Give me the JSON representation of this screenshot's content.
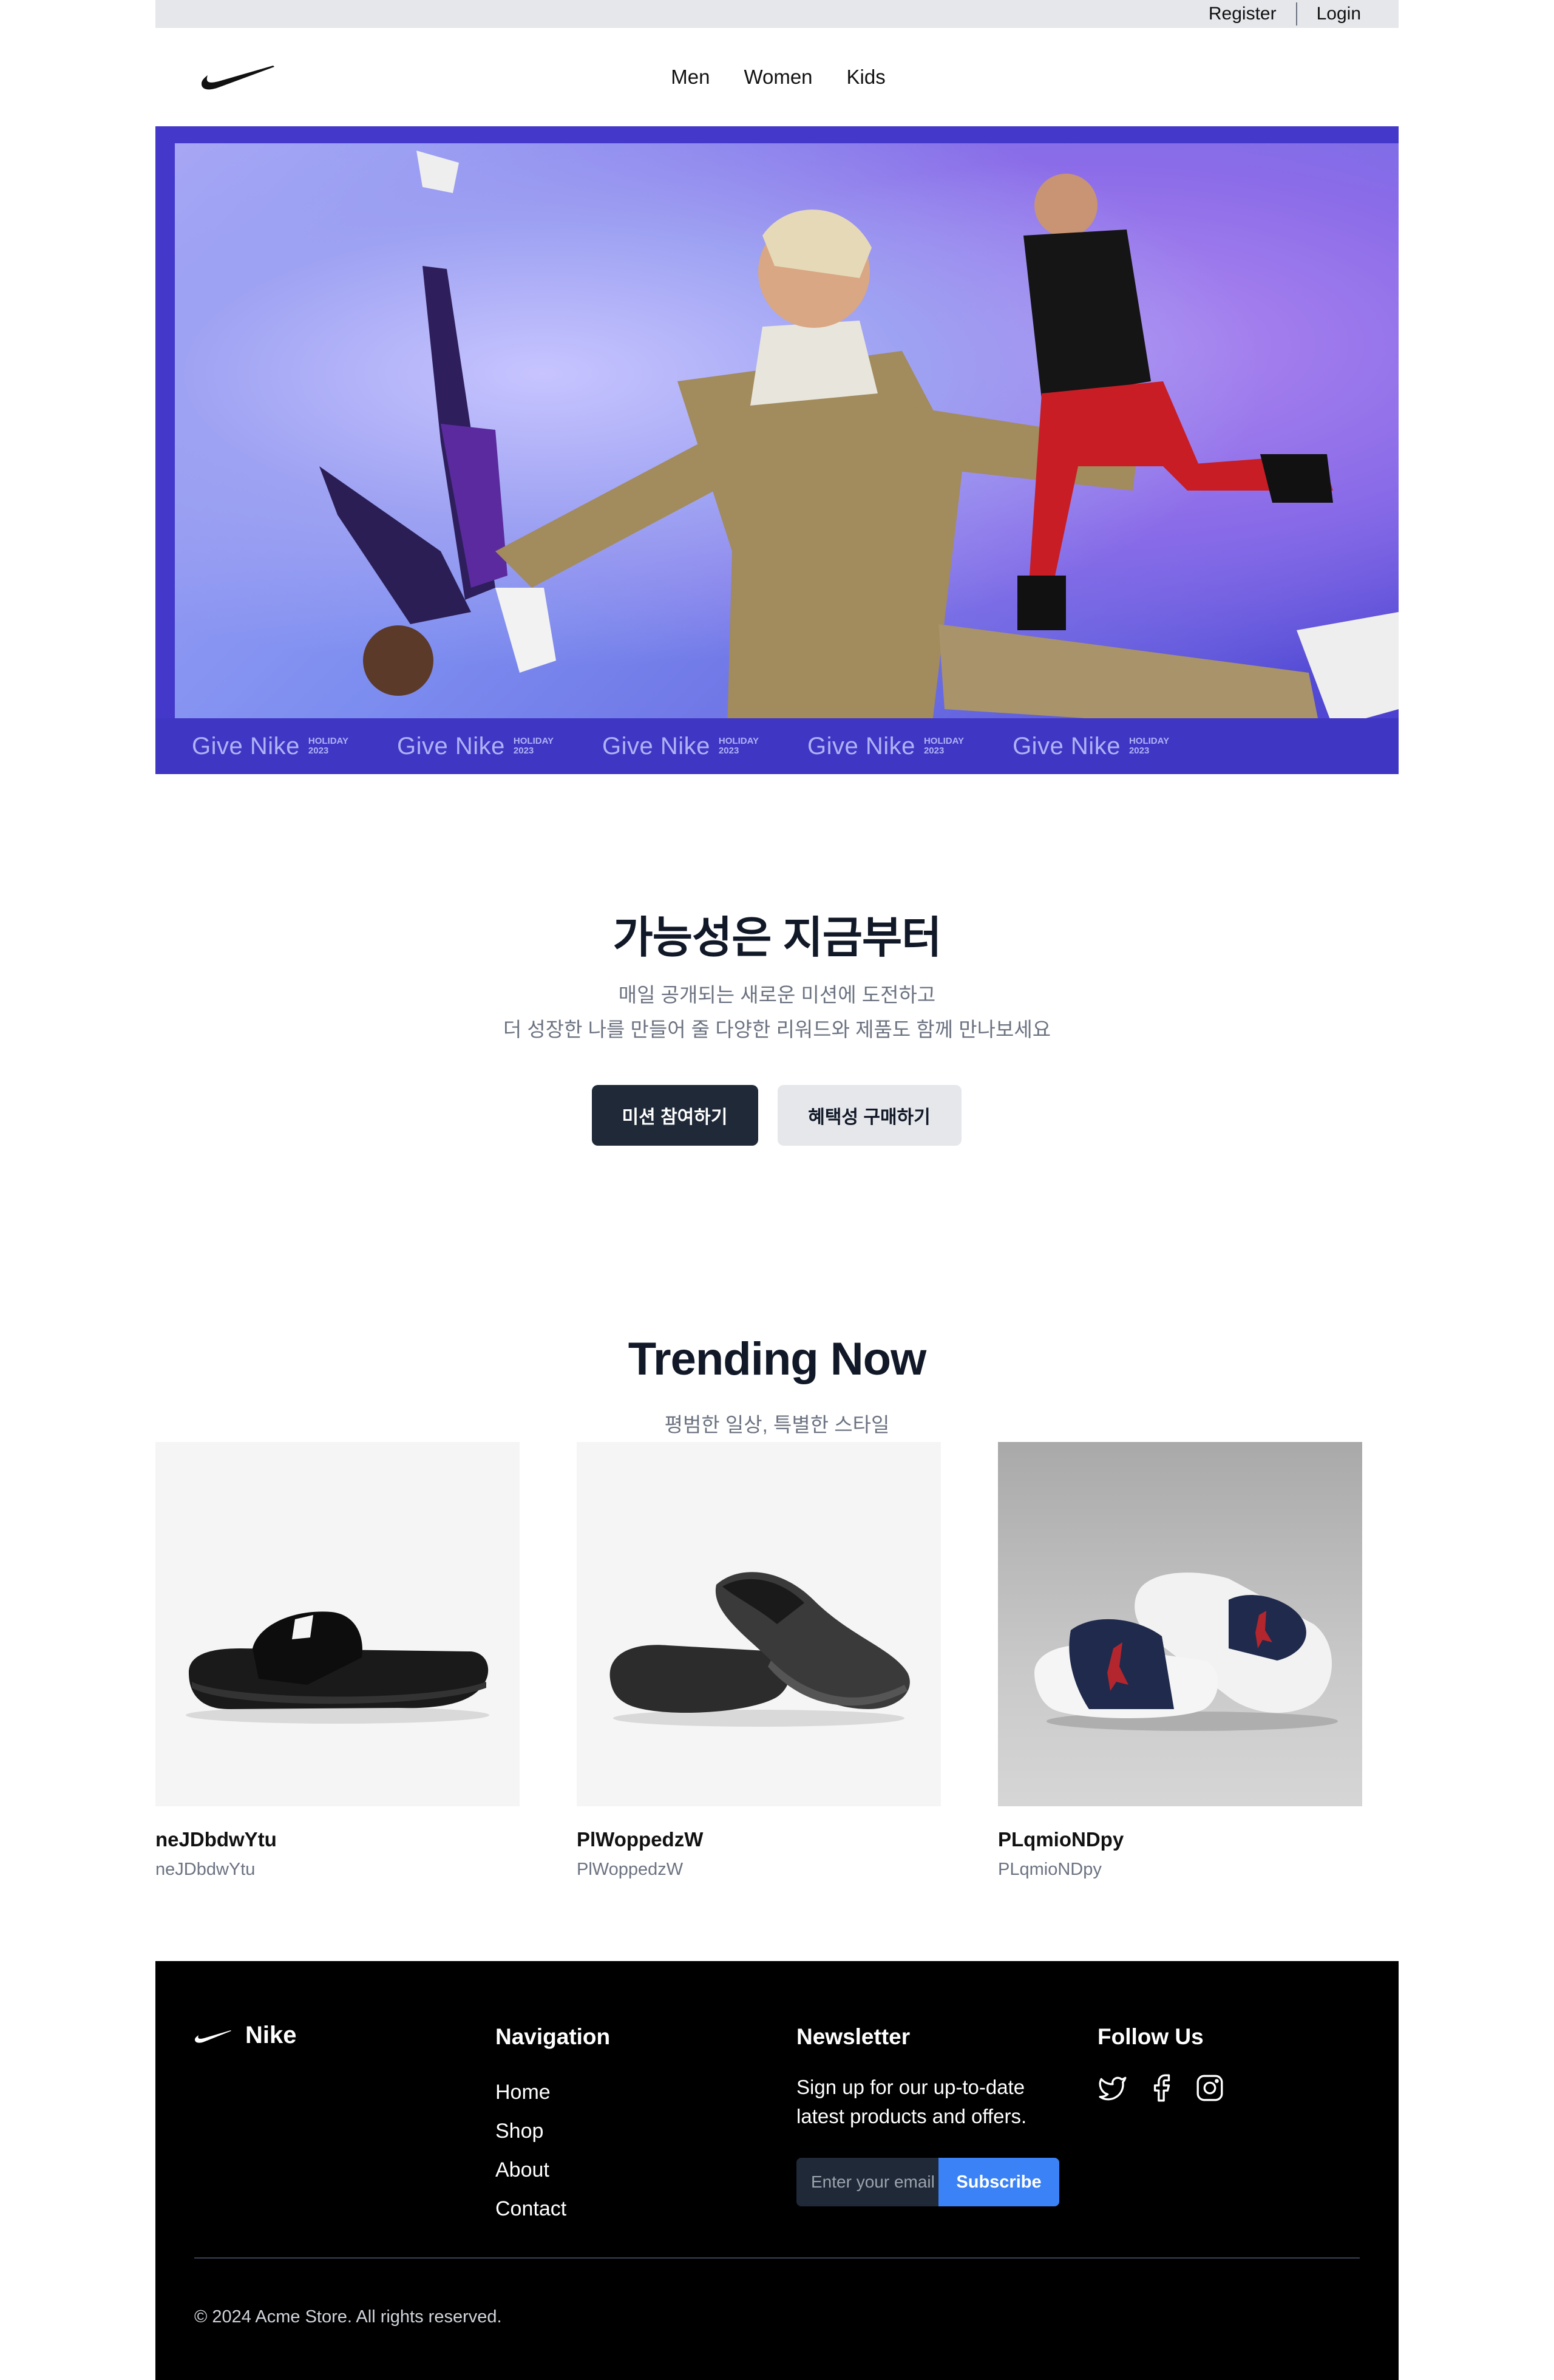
{
  "topbar": {
    "register": "Register",
    "login": "Login"
  },
  "header": {
    "logo_icon": "nike-swoosh-icon",
    "nav": [
      "Men",
      "Women",
      "Kids"
    ]
  },
  "hero": {
    "strip_text": "Give Nike",
    "strip_badge_top": "HOLIDAY",
    "strip_badge_bottom": "2023",
    "colors": {
      "frame": "#4338ca",
      "strip": "#3f36c4"
    }
  },
  "mission": {
    "title": "가능성은 지금부터",
    "line1": "매일 공개되는 새로운 미션에 도전하고",
    "line2": "더 성장한 나를 만들어 줄 다양한 리워드와 제품도 함께 만나보세요",
    "primary_button": "미션 참여하기",
    "secondary_button": "혜택성 구매하기"
  },
  "trending": {
    "title": "Trending Now",
    "subtitle": "평범한 일상, 특별한 스타일",
    "products": [
      {
        "name": "neJDbdwYtu",
        "desc": "neJDbdwYtu",
        "image": "black-slide-sandal"
      },
      {
        "name": "PlWoppedzW",
        "desc": "PlWoppedzW",
        "image": "black-flip-flop"
      },
      {
        "name": "PLqmioNDpy",
        "desc": "PLqmioNDpy",
        "image": "jordan-navy-white-slides"
      }
    ]
  },
  "footer": {
    "brand": "Nike",
    "nav_title": "Navigation",
    "nav_links": [
      "Home",
      "Shop",
      "About",
      "Contact"
    ],
    "newsletter_title": "Newsletter",
    "newsletter_text": "Sign up for our up-to-date latest products and offers.",
    "email_placeholder": "Enter your email",
    "subscribe": "Subscribe",
    "follow_title": "Follow Us",
    "social_icons": [
      "twitter-icon",
      "facebook-icon",
      "instagram-icon"
    ],
    "copyright": "© 2024 Acme Store. All rights reserved.",
    "colors": {
      "background": "#000000",
      "subscribe": "#3b82f6"
    }
  }
}
